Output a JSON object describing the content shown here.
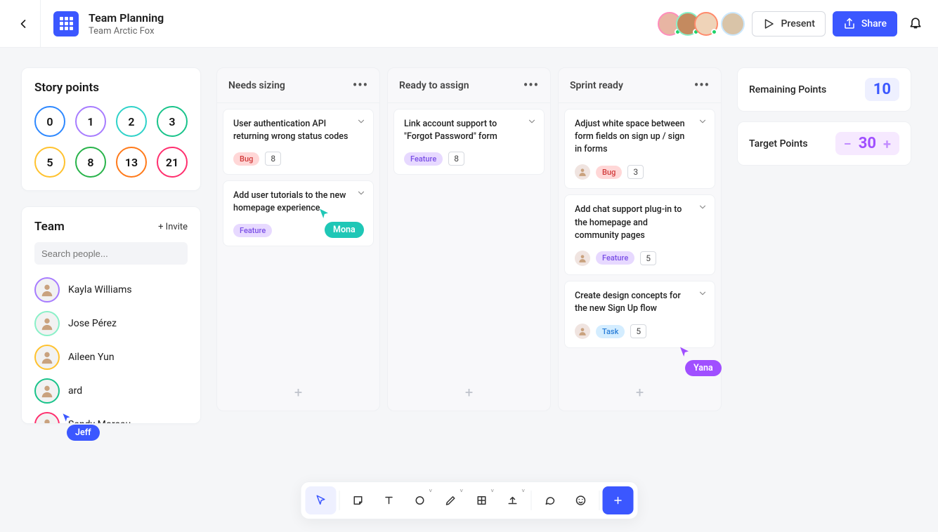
{
  "header": {
    "title": "Team Planning",
    "subtitle": "Team Arctic Fox",
    "present_label": "Present",
    "share_label": "Share"
  },
  "story_points": {
    "title": "Story points",
    "values": [
      "0",
      "1",
      "2",
      "3",
      "5",
      "8",
      "13",
      "21"
    ],
    "colors": [
      "#2d88ff",
      "#a77cff",
      "#2fd2c9",
      "#19c38a",
      "#ffc22e",
      "#28b34a",
      "#ff7a1a",
      "#ff2f6e"
    ]
  },
  "team": {
    "title": "Team",
    "invite_label": "+ Invite",
    "search_placeholder": "Search people...",
    "members": [
      {
        "name": "Kayla Williams",
        "ring": "#a77cff"
      },
      {
        "name": "Jose Pérez",
        "ring": "#8af0c8"
      },
      {
        "name": "Aileen Yun",
        "ring": "#ffc22e"
      },
      {
        "name": "ard",
        "ring": "#19c38a"
      },
      {
        "name": "Sandy Moreau",
        "ring": "#ff2f6e"
      }
    ]
  },
  "board": {
    "columns": [
      {
        "title": "Needs sizing",
        "cards": [
          {
            "title": "User authentication API returning wrong status codes",
            "badge": "Bug",
            "badgeClass": "badge-bug",
            "num": "8",
            "avatar": false
          },
          {
            "title": "Add user tutorials to the new homepage experience",
            "badge": "Feature",
            "badgeClass": "badge-feature",
            "num": null,
            "avatar": false
          }
        ]
      },
      {
        "title": "Ready to assign",
        "cards": [
          {
            "title": "Link account support to \"Forgot Password\" form",
            "badge": "Feature",
            "badgeClass": "badge-feature",
            "num": "8",
            "avatar": false
          }
        ]
      },
      {
        "title": "Sprint ready",
        "cards": [
          {
            "title": "Adjust white space between form fields on sign up / sign in forms",
            "badge": "Bug",
            "badgeClass": "badge-bug",
            "num": "3",
            "avatar": true
          },
          {
            "title": "Add chat support plug-in to the homepage and community pages",
            "badge": "Feature",
            "badgeClass": "badge-feature",
            "num": "5",
            "avatar": true
          },
          {
            "title": "Create design concepts for the new Sign Up flow",
            "badge": "Task",
            "badgeClass": "badge-task",
            "num": "5",
            "avatar": true
          }
        ]
      }
    ]
  },
  "stats": {
    "remaining_label": "Remaining Points",
    "remaining_value": "10",
    "target_label": "Target Points",
    "target_value": "30"
  },
  "cursors": {
    "mona": "Mona",
    "yana": "Yana",
    "jeff": "Jeff"
  },
  "toolbar_plus": "+"
}
